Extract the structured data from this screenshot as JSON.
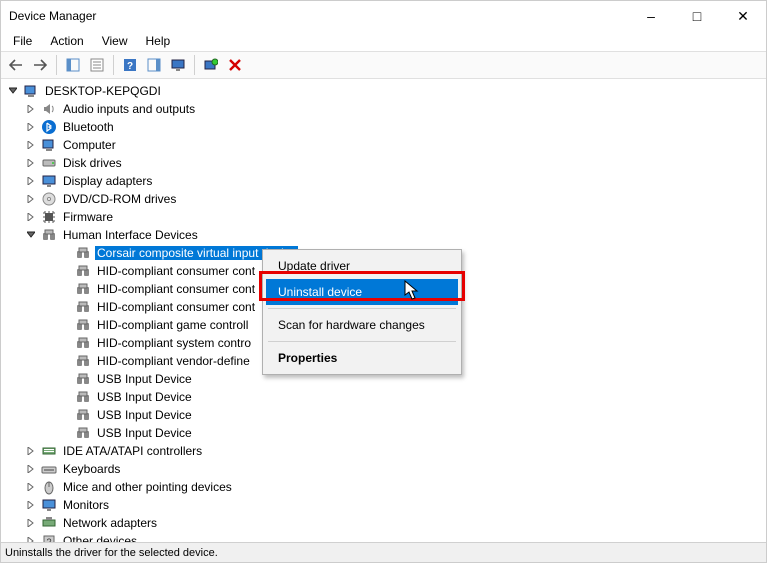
{
  "title": "Device Manager",
  "menus": [
    "File",
    "Action",
    "View",
    "Help"
  ],
  "toolbar_tips": {
    "back": "Back",
    "forward": "Forward",
    "show_hide": "Show/Hide Console Tree",
    "properties": "Properties",
    "help": "Help",
    "action_center": "Action Center",
    "monitor": "Monitor",
    "scan": "Scan for hardware changes",
    "uninstall": "Uninstall device"
  },
  "root_name": "DESKTOP-KEPQGDI",
  "nodes": [
    {
      "label": "Audio inputs and outputs",
      "icon": "speaker",
      "exp": ">"
    },
    {
      "label": "Bluetooth",
      "icon": "bluetooth",
      "exp": ">"
    },
    {
      "label": "Computer",
      "icon": "computer",
      "exp": ">"
    },
    {
      "label": "Disk drives",
      "icon": "disk",
      "exp": ">"
    },
    {
      "label": "Display adapters",
      "icon": "display",
      "exp": ">"
    },
    {
      "label": "DVD/CD-ROM drives",
      "icon": "cd",
      "exp": ">"
    },
    {
      "label": "Firmware",
      "icon": "chip",
      "exp": ">"
    },
    {
      "label": "Human Interface Devices",
      "icon": "hid",
      "exp": "v",
      "children": [
        {
          "label": "Corsair composite virtual input device",
          "icon": "hid",
          "selected": true
        },
        {
          "label": "HID-compliant consumer control device",
          "icon": "hid",
          "cut": true
        },
        {
          "label": "HID-compliant consumer control device",
          "icon": "hid",
          "cut": true
        },
        {
          "label": "HID-compliant consumer control device",
          "icon": "hid",
          "cut": true
        },
        {
          "label": "HID-compliant game controller",
          "icon": "hid",
          "cut": true
        },
        {
          "label": "HID-compliant system controller",
          "icon": "hid",
          "cut": true
        },
        {
          "label": "HID-compliant vendor-defined device",
          "icon": "hid",
          "cut": true
        },
        {
          "label": "USB Input Device",
          "icon": "hid"
        },
        {
          "label": "USB Input Device",
          "icon": "hid"
        },
        {
          "label": "USB Input Device",
          "icon": "hid"
        },
        {
          "label": "USB Input Device",
          "icon": "hid"
        }
      ]
    },
    {
      "label": "IDE ATA/ATAPI controllers",
      "icon": "ide",
      "exp": ">"
    },
    {
      "label": "Keyboards",
      "icon": "keyboard",
      "exp": ">"
    },
    {
      "label": "Mice and other pointing devices",
      "icon": "mouse",
      "exp": ">"
    },
    {
      "label": "Monitors",
      "icon": "monitor",
      "exp": ">"
    },
    {
      "label": "Network adapters",
      "icon": "net",
      "exp": ">"
    },
    {
      "label": "Other devices",
      "icon": "other",
      "exp": ">"
    }
  ],
  "context_menu": {
    "items": [
      {
        "label": "Update driver"
      },
      {
        "label": "Uninstall device",
        "hover": true
      },
      {
        "sep": true
      },
      {
        "label": "Scan for hardware changes"
      },
      {
        "sep": true
      },
      {
        "label": "Properties",
        "bold": true
      }
    ]
  },
  "status_text": "Uninstalls the driver for the selected device."
}
